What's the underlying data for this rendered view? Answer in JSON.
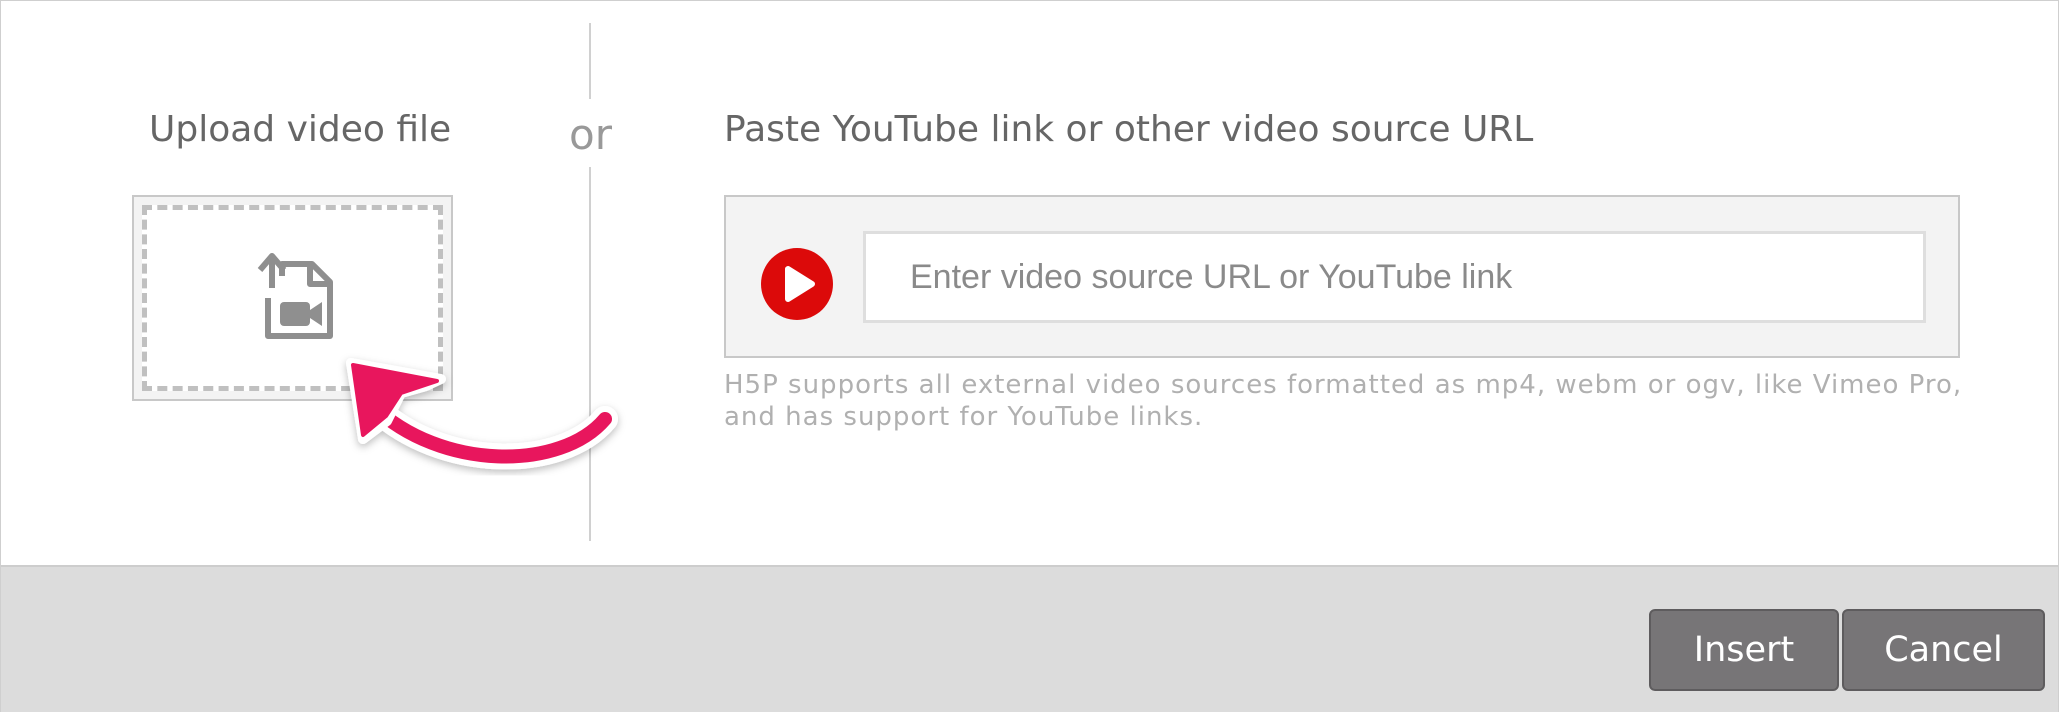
{
  "upload": {
    "title": "Upload video file",
    "icon": "upload-video-file-icon"
  },
  "separator": {
    "label": "or"
  },
  "url": {
    "title": "Paste YouTube link or other video source URL",
    "input_value": "",
    "input_placeholder": "Enter video source URL or YouTube link",
    "play_icon": "play-icon",
    "help_text": "H5P supports all external video sources formatted as mp4, webm or ogv, like Vimeo Pro, and has support for YouTube links."
  },
  "footer": {
    "insert_label": "Insert",
    "cancel_label": "Cancel"
  },
  "colors": {
    "accent_arrow": "#e8175d",
    "play_red": "#dc0a0a",
    "button_bg": "#777577",
    "footer_bg": "#dcdcdc"
  }
}
